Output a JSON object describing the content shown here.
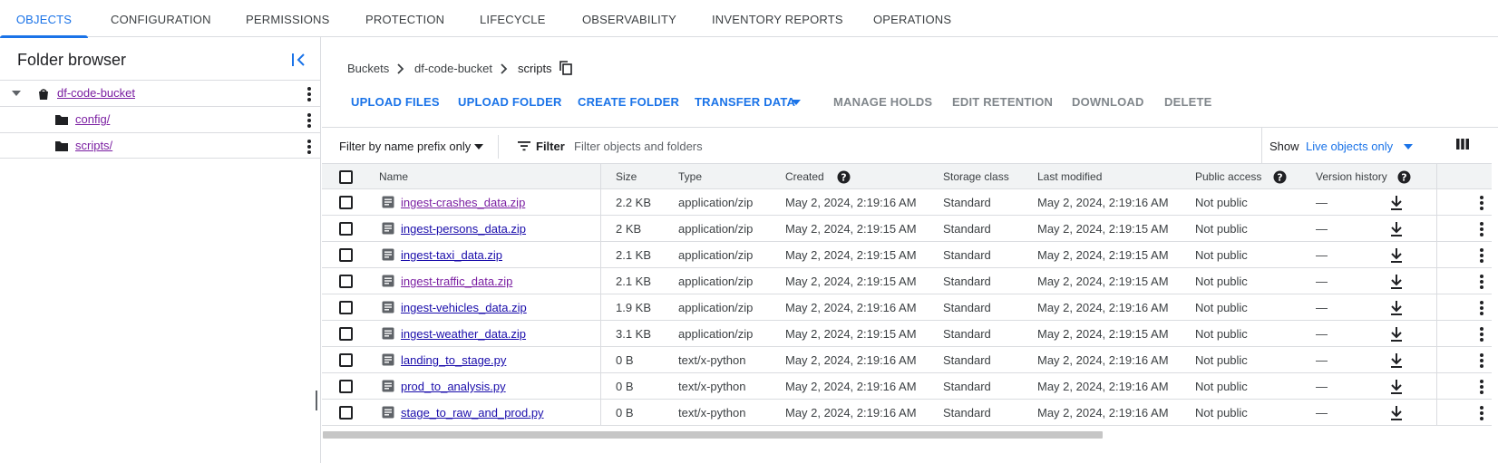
{
  "tabs": [
    {
      "label": "OBJECTS",
      "active": true
    },
    {
      "label": "CONFIGURATION"
    },
    {
      "label": "PERMISSIONS"
    },
    {
      "label": "PROTECTION"
    },
    {
      "label": "LIFECYCLE"
    },
    {
      "label": "OBSERVABILITY"
    },
    {
      "label": "INVENTORY REPORTS"
    },
    {
      "label": "OPERATIONS"
    }
  ],
  "folder_browser": {
    "title": "Folder browser",
    "items": [
      {
        "label": "df-code-bucket",
        "icon": "bucket-icon",
        "expanded": true
      },
      {
        "label": "config/",
        "icon": "folder-icon"
      },
      {
        "label": "scripts/",
        "icon": "folder-icon"
      }
    ]
  },
  "breadcrumb": [
    "Buckets",
    "df-code-bucket",
    "scripts"
  ],
  "toolbar": {
    "upload_files": "UPLOAD FILES",
    "upload_folder": "UPLOAD FOLDER",
    "create_folder": "CREATE FOLDER",
    "transfer_data": "TRANSFER DATA",
    "manage_holds": "MANAGE HOLDS",
    "edit_retention": "EDIT RETENTION",
    "download": "DOWNLOAD",
    "delete": "DELETE"
  },
  "filter": {
    "prefix_label": "Filter by name prefix only",
    "filter_label": "Filter",
    "placeholder": "Filter objects and folders",
    "show_label": "Show",
    "show_value": "Live objects only"
  },
  "table": {
    "columns": [
      "Name",
      "Size",
      "Type",
      "Created",
      "Storage class",
      "Last modified",
      "Public access",
      "Version history"
    ],
    "rows": [
      {
        "name": "ingest-crashes_data.zip",
        "size": "2.2 KB",
        "type": "application/zip",
        "created": "May 2, 2024, 2:19:16 AM",
        "storage": "Standard",
        "modified": "May 2, 2024, 2:19:16 AM",
        "public": "Not public",
        "version": "—",
        "visited": true
      },
      {
        "name": "ingest-persons_data.zip",
        "size": "2 KB",
        "type": "application/zip",
        "created": "May 2, 2024, 2:19:15 AM",
        "storage": "Standard",
        "modified": "May 2, 2024, 2:19:15 AM",
        "public": "Not public",
        "version": "—",
        "visited": false
      },
      {
        "name": "ingest-taxi_data.zip",
        "size": "2.1 KB",
        "type": "application/zip",
        "created": "May 2, 2024, 2:19:15 AM",
        "storage": "Standard",
        "modified": "May 2, 2024, 2:19:15 AM",
        "public": "Not public",
        "version": "—",
        "visited": false
      },
      {
        "name": "ingest-traffic_data.zip",
        "size": "2.1 KB",
        "type": "application/zip",
        "created": "May 2, 2024, 2:19:15 AM",
        "storage": "Standard",
        "modified": "May 2, 2024, 2:19:15 AM",
        "public": "Not public",
        "version": "—",
        "visited": true
      },
      {
        "name": "ingest-vehicles_data.zip",
        "size": "1.9 KB",
        "type": "application/zip",
        "created": "May 2, 2024, 2:19:16 AM",
        "storage": "Standard",
        "modified": "May 2, 2024, 2:19:16 AM",
        "public": "Not public",
        "version": "—",
        "visited": false
      },
      {
        "name": "ingest-weather_data.zip",
        "size": "3.1 KB",
        "type": "application/zip",
        "created": "May 2, 2024, 2:19:15 AM",
        "storage": "Standard",
        "modified": "May 2, 2024, 2:19:15 AM",
        "public": "Not public",
        "version": "—",
        "visited": false
      },
      {
        "name": "landing_to_stage.py",
        "size": "0 B",
        "type": "text/x-python",
        "created": "May 2, 2024, 2:19:16 AM",
        "storage": "Standard",
        "modified": "May 2, 2024, 2:19:16 AM",
        "public": "Not public",
        "version": "—",
        "visited": false
      },
      {
        "name": "prod_to_analysis.py",
        "size": "0 B",
        "type": "text/x-python",
        "created": "May 2, 2024, 2:19:16 AM",
        "storage": "Standard",
        "modified": "May 2, 2024, 2:19:16 AM",
        "public": "Not public",
        "version": "—",
        "visited": false
      },
      {
        "name": "stage_to_raw_and_prod.py",
        "size": "0 B",
        "type": "text/x-python",
        "created": "May 2, 2024, 2:19:16 AM",
        "storage": "Standard",
        "modified": "May 2, 2024, 2:19:16 AM",
        "public": "Not public",
        "version": "—",
        "visited": false
      }
    ]
  },
  "colors": {
    "accent": "#1a73e8",
    "visited_link": "#7b1fa2",
    "link": "#1a0dab",
    "disabled": "#80868b",
    "header_bg": "#f1f3f4",
    "border": "#dadce0"
  }
}
